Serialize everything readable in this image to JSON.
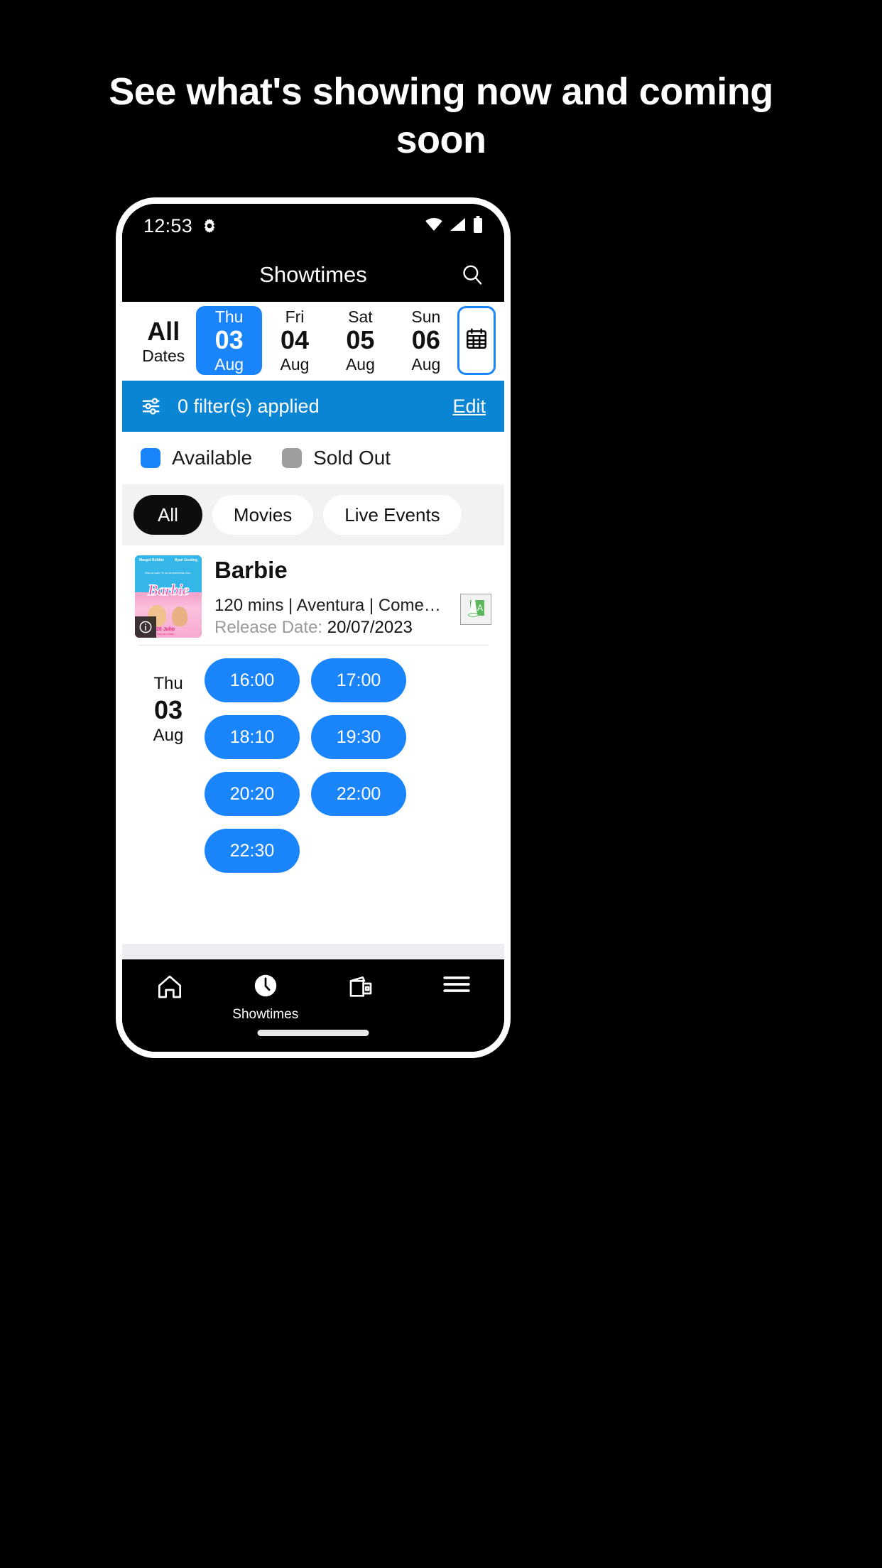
{
  "promo": {
    "heading": "See what's showing now and coming soon"
  },
  "status_bar": {
    "time": "12:53",
    "gear_icon": "gear-icon",
    "wifi_icon": "wifi-icon",
    "signal_icon": "cellular-signal-icon",
    "battery_icon": "battery-icon"
  },
  "app_bar": {
    "title": "Showtimes",
    "search_icon": "search-icon"
  },
  "date_strip": {
    "calendar_icon": "calendar-icon",
    "dates": [
      {
        "dow": "",
        "num": "All",
        "mon": "Dates",
        "selected": false
      },
      {
        "dow": "Thu",
        "num": "03",
        "mon": "Aug",
        "selected": true
      },
      {
        "dow": "Fri",
        "num": "04",
        "mon": "Aug",
        "selected": false
      },
      {
        "dow": "Sat",
        "num": "05",
        "mon": "Aug",
        "selected": false
      },
      {
        "dow": "Sun",
        "num": "06",
        "mon": "Aug",
        "selected": false
      }
    ]
  },
  "filter_bar": {
    "icon": "filter-sliders-icon",
    "text": "0 filter(s) applied",
    "edit_label": "Edit",
    "background": "#0a85d4"
  },
  "legend": {
    "items": [
      {
        "label": "Available",
        "color": "#1a84fb"
      },
      {
        "label": "Sold Out",
        "color": "#9e9e9e"
      }
    ]
  },
  "tabs": [
    {
      "label": "All",
      "active": true
    },
    {
      "label": "Movies",
      "active": false
    },
    {
      "label": "Live Events",
      "active": false
    }
  ],
  "movie": {
    "title": "Barbie",
    "details": "120 mins | Aventura | Comedia ...",
    "release_label": "Release Date:",
    "release_date": "20/07/2023",
    "rating_badge": "A",
    "info_icon": "info-icon",
    "poster": {
      "actor_left": "Margot Robbie",
      "actor_right": "Ryan Gosling",
      "tagline": "Ella es todo. El es simplemente Ken.",
      "logo": "Barbie",
      "date": "20 Julio",
      "date_sub": "Solo en cines"
    }
  },
  "showtimes": {
    "date": {
      "dow": "Thu",
      "num": "03",
      "mon": "Aug"
    },
    "times": [
      {
        "time": "16:00",
        "status": "available"
      },
      {
        "time": "17:00",
        "status": "available"
      },
      {
        "time": "18:10",
        "status": "available"
      },
      {
        "time": "19:30",
        "status": "available"
      },
      {
        "time": "20:20",
        "status": "available"
      },
      {
        "time": "22:00",
        "status": "available"
      },
      {
        "time": "22:30",
        "status": "available"
      }
    ]
  },
  "bottom_nav": [
    {
      "icon": "home-icon",
      "label": "",
      "active": false
    },
    {
      "icon": "clock-icon",
      "label": "Showtimes",
      "active": true
    },
    {
      "icon": "wallet-ticket-icon",
      "label": "",
      "active": false
    },
    {
      "icon": "hamburger-menu-icon",
      "label": "",
      "active": false
    }
  ],
  "colors": {
    "accent_blue": "#1a84fb",
    "filter_blue": "#0a85d4",
    "sold_out_gray": "#9e9e9e",
    "tab_active": "#0d0d0d"
  }
}
